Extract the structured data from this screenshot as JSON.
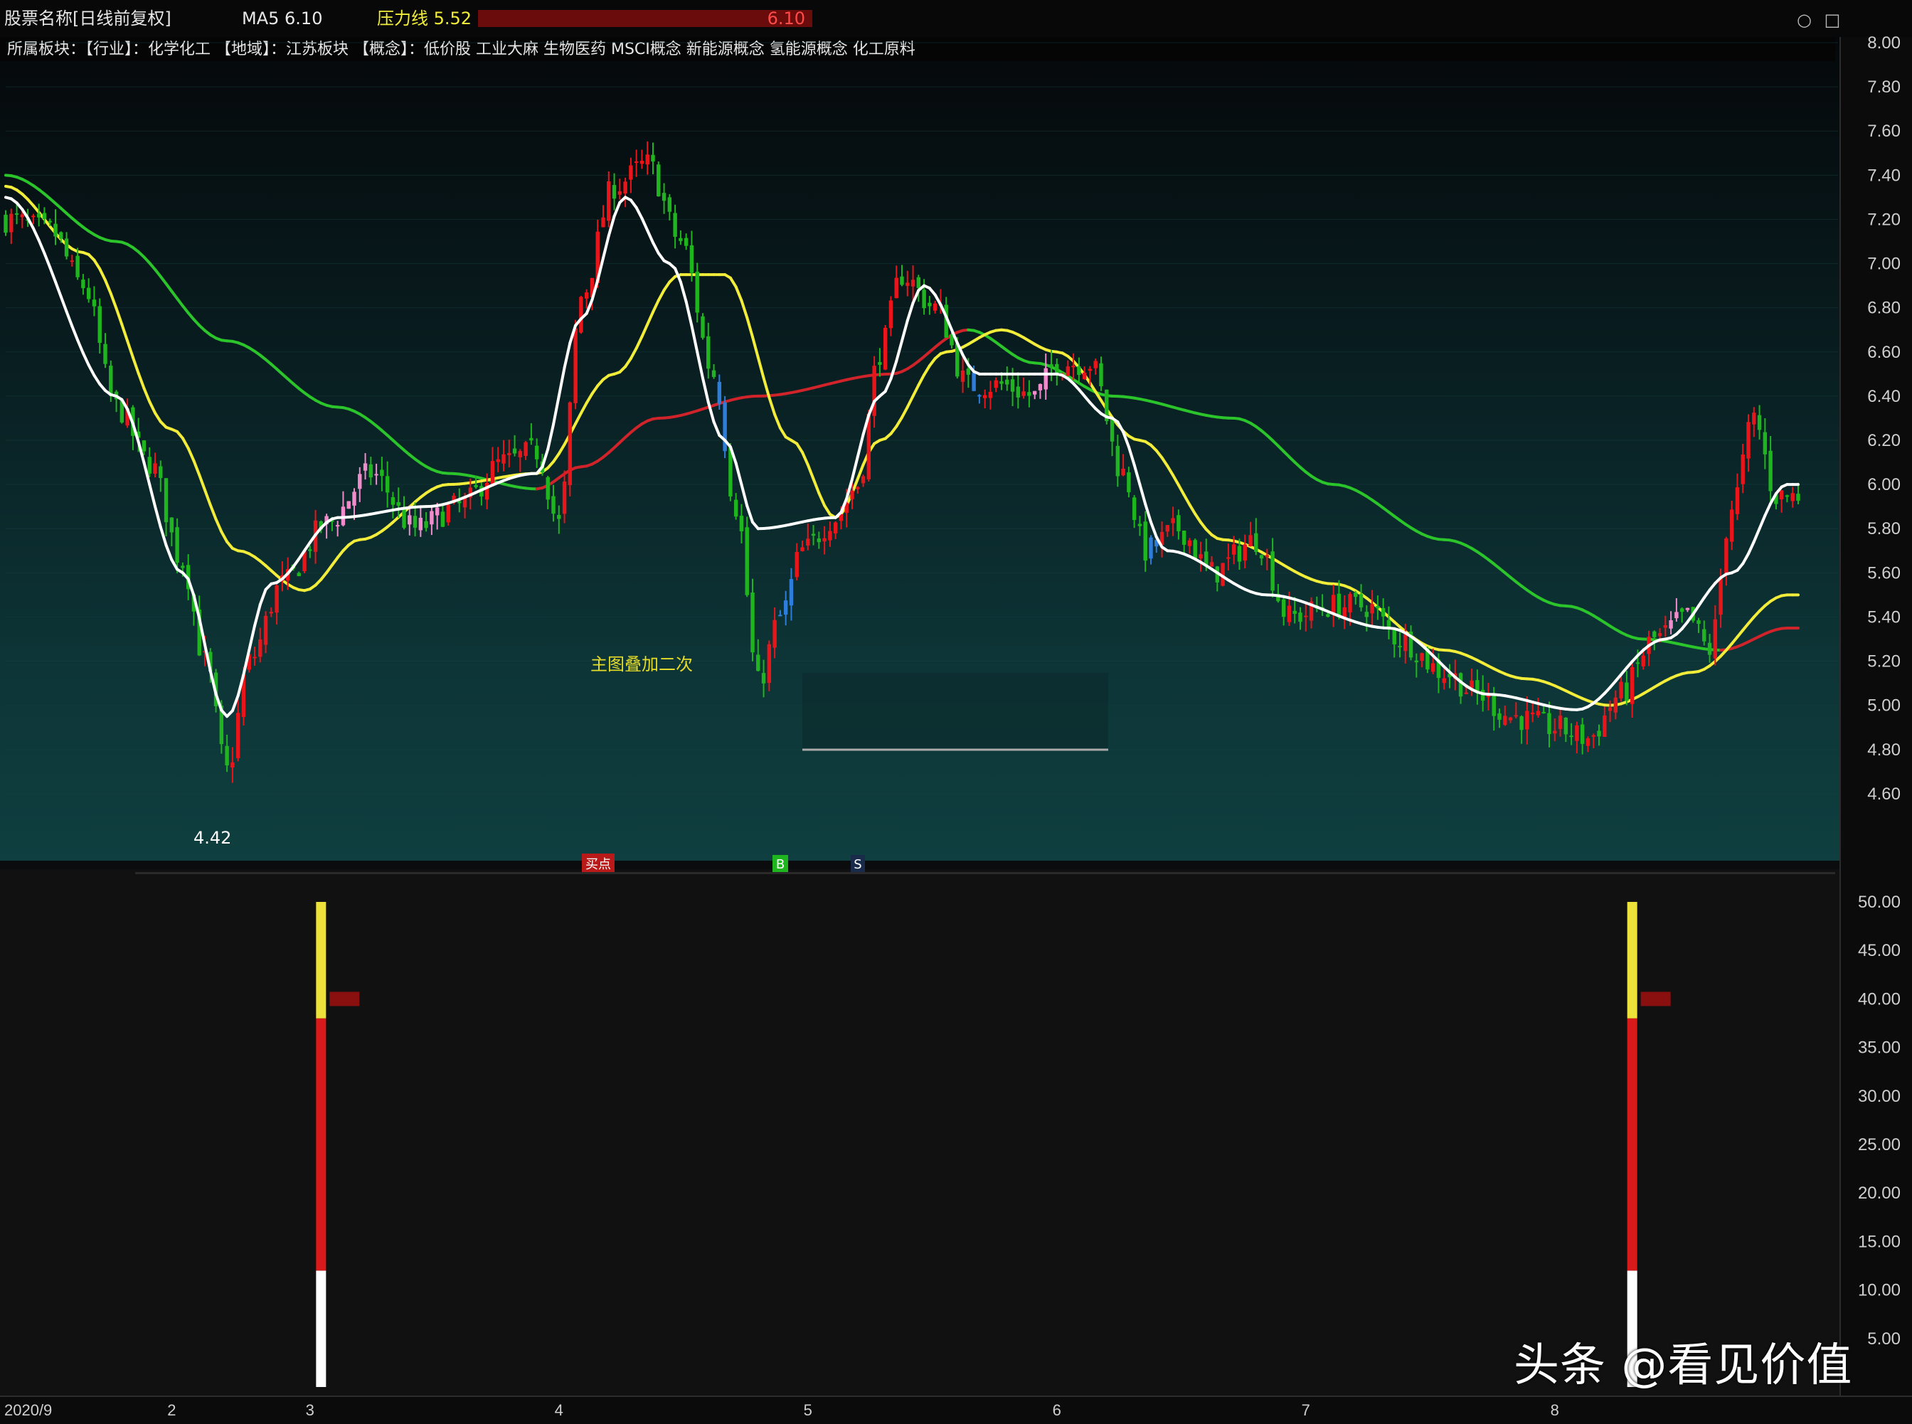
{
  "header": {
    "title": "股票名称[日线前复权]",
    "indicator_1": "MA5 6.10",
    "indicator_2": "压力线 5.52",
    "indicator_3": "6.10",
    "info_line": "所属板块：【行业】：化学化工 【地域】：江苏板块 【概念】：低价股 工业大麻 生物医药 MSCI概念 新能源概念 氢能源概念 化工原料"
  },
  "colors": {
    "up": "#e8161b",
    "down": "#1fb51f",
    "pink": "#f08ccc",
    "blue": "#2e7ddb",
    "ma_short": "#ffffff",
    "ma_mid": "#f2ec3a",
    "ma_long_up": "#2bc52b",
    "ma_long_down": "#d0232a",
    "bar_white": "#ffffff",
    "bar_red": "#d81a1a",
    "bar_yellow": "#ece23a"
  },
  "annotations": {
    "low_label": "4.42",
    "middle_label": "主图叠加二次",
    "signal_1": "买点",
    "signal_2": "B",
    "signal_3": "S"
  },
  "watermark": "头条 @看见价值",
  "window_icons": [
    "restore-icon",
    "maximize-icon"
  ],
  "chart_data": [
    {
      "type": "candlestick",
      "panel": "main",
      "title": "",
      "ylim": [
        4.4,
        8.0
      ],
      "y_ticks": [
        "8.00",
        "7.80",
        "7.60",
        "7.40",
        "7.20",
        "7.00",
        "6.80",
        "6.60",
        "6.40",
        "6.20",
        "6.00",
        "5.80",
        "5.60",
        "5.40",
        "5.20",
        "5.00",
        "4.80",
        "4.60"
      ],
      "x_labels": [
        "2020/9",
        "2",
        "3",
        "4",
        "5",
        "6",
        "7",
        "8"
      ],
      "x_label_days": [
        0,
        30,
        55,
        100,
        145,
        190,
        235,
        280
      ],
      "n_days": 325,
      "price_anchors": [
        [
          0,
          7.2
        ],
        [
          8,
          7.15
        ],
        [
          14,
          6.9
        ],
        [
          20,
          6.35
        ],
        [
          26,
          6.1
        ],
        [
          32,
          5.65
        ],
        [
          36,
          5.2
        ],
        [
          40,
          4.7
        ],
        [
          44,
          5.2
        ],
        [
          50,
          5.55
        ],
        [
          58,
          5.82
        ],
        [
          66,
          6.05
        ],
        [
          74,
          5.8
        ],
        [
          82,
          5.9
        ],
        [
          90,
          6.1
        ],
        [
          96,
          6.15
        ],
        [
          100,
          5.82
        ],
        [
          104,
          6.85
        ],
        [
          110,
          7.35
        ],
        [
          116,
          7.45
        ],
        [
          122,
          7.1
        ],
        [
          128,
          6.5
        ],
        [
          132,
          5.9
        ],
        [
          136,
          5.1
        ],
        [
          140,
          5.4
        ],
        [
          144,
          5.7
        ],
        [
          150,
          5.85
        ],
        [
          154,
          6.0
        ],
        [
          158,
          6.6
        ],
        [
          162,
          6.95
        ],
        [
          168,
          6.8
        ],
        [
          174,
          6.45
        ],
        [
          180,
          6.45
        ],
        [
          186,
          6.4
        ],
        [
          190,
          6.55
        ],
        [
          196,
          6.55
        ],
        [
          202,
          6.05
        ],
        [
          206,
          5.7
        ],
        [
          212,
          5.8
        ],
        [
          218,
          5.6
        ],
        [
          226,
          5.75
        ],
        [
          232,
          5.4
        ],
        [
          240,
          5.45
        ],
        [
          246,
          5.45
        ],
        [
          252,
          5.3
        ],
        [
          260,
          5.15
        ],
        [
          266,
          5.05
        ],
        [
          272,
          4.95
        ],
        [
          280,
          4.9
        ],
        [
          286,
          4.85
        ],
        [
          292,
          5.05
        ],
        [
          298,
          5.3
        ],
        [
          304,
          5.4
        ],
        [
          308,
          5.25
        ],
        [
          312,
          5.9
        ],
        [
          316,
          6.3
        ],
        [
          320,
          5.95
        ]
      ],
      "ma_short_anchors": [
        [
          0,
          7.3
        ],
        [
          20,
          6.4
        ],
        [
          32,
          5.6
        ],
        [
          40,
          4.95
        ],
        [
          48,
          5.55
        ],
        [
          60,
          5.85
        ],
        [
          76,
          5.9
        ],
        [
          96,
          6.05
        ],
        [
          104,
          6.75
        ],
        [
          112,
          7.3
        ],
        [
          120,
          7.0
        ],
        [
          130,
          6.2
        ],
        [
          136,
          5.8
        ],
        [
          150,
          5.85
        ],
        [
          158,
          6.4
        ],
        [
          166,
          6.9
        ],
        [
          176,
          6.5
        ],
        [
          190,
          6.5
        ],
        [
          200,
          6.3
        ],
        [
          210,
          5.7
        ],
        [
          228,
          5.5
        ],
        [
          250,
          5.35
        ],
        [
          268,
          5.05
        ],
        [
          284,
          4.98
        ],
        [
          300,
          5.3
        ],
        [
          312,
          5.6
        ],
        [
          322,
          6.0
        ]
      ],
      "ma_mid_anchors": [
        [
          0,
          7.35
        ],
        [
          14,
          7.05
        ],
        [
          30,
          6.25
        ],
        [
          42,
          5.7
        ],
        [
          54,
          5.52
        ],
        [
          64,
          5.75
        ],
        [
          80,
          6.0
        ],
        [
          96,
          6.05
        ],
        [
          110,
          6.5
        ],
        [
          122,
          6.95
        ],
        [
          130,
          6.95
        ],
        [
          142,
          6.2
        ],
        [
          150,
          5.85
        ],
        [
          158,
          6.2
        ],
        [
          170,
          6.6
        ],
        [
          180,
          6.7
        ],
        [
          190,
          6.6
        ],
        [
          205,
          6.2
        ],
        [
          220,
          5.75
        ],
        [
          240,
          5.55
        ],
        [
          260,
          5.25
        ],
        [
          275,
          5.12
        ],
        [
          290,
          5.0
        ],
        [
          305,
          5.15
        ],
        [
          322,
          5.5
        ]
      ],
      "ma_long_anchors": [
        [
          0,
          7.4
        ],
        [
          20,
          7.1
        ],
        [
          40,
          6.65
        ],
        [
          60,
          6.35
        ],
        [
          80,
          6.05
        ],
        [
          96,
          5.98
        ],
        [
          104,
          6.08
        ],
        [
          118,
          6.3
        ],
        [
          136,
          6.4
        ],
        [
          160,
          6.5
        ],
        [
          174,
          6.7
        ],
        [
          186,
          6.55
        ],
        [
          200,
          6.4
        ],
        [
          222,
          6.3
        ],
        [
          240,
          6.0
        ],
        [
          260,
          5.75
        ],
        [
          282,
          5.45
        ],
        [
          296,
          5.3
        ],
        [
          310,
          5.25
        ],
        [
          322,
          5.35
        ]
      ]
    },
    {
      "type": "bar",
      "panel": "sub",
      "title": "",
      "ylim": [
        0,
        50
      ],
      "y_ticks": [
        "50.00",
        "45.00",
        "40.00",
        "35.00",
        "30.00",
        "25.00",
        "20.00",
        "15.00",
        "10.00",
        "5.00"
      ],
      "bars": [
        {
          "day": 57,
          "segments": [
            {
              "from": 0,
              "to": 12,
              "color": "white"
            },
            {
              "from": 12,
              "to": 38,
              "color": "red"
            },
            {
              "from": 38,
              "to": 50,
              "color": "yellow"
            }
          ],
          "marker": 40
        },
        {
          "day": 294,
          "segments": [
            {
              "from": 0,
              "to": 12,
              "color": "white"
            },
            {
              "from": 12,
              "to": 38,
              "color": "red"
            },
            {
              "from": 38,
              "to": 50,
              "color": "yellow"
            }
          ],
          "marker": 40
        }
      ]
    }
  ]
}
